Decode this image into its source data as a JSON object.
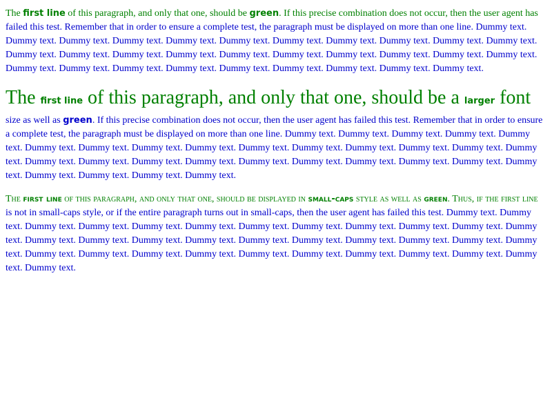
{
  "paragraphs": [
    {
      "intro": "The ",
      "bold1": "first line",
      "mid": " of this paragraph, and only that one, should be ",
      "bold2": "green",
      "rest": ". If this precise combination does not occur, then the user agent has failed this test. Remember that in order to ensure a complete test, the paragraph must be displayed on more than one line. Dummy text. Dummy text. Dummy text. Dummy text. Dummy text. Dummy text. Dummy text. Dummy text. Dummy text. Dummy text. Dummy text. Dummy text. Dummy text. Dummy text. Dummy text. Dummy text. Dummy text. Dummy text. Dummy text. Dummy text. Dummy text. Dummy text. Dummy text. Dummy text. Dummy text. Dummy text. Dummy text. Dummy text. Dummy text. Dummy text."
    },
    {
      "intro": "The ",
      "bold1": "first line",
      "mid": " of this paragraph, and only that one, should be a ",
      "bold2": "larger",
      "mid2": " font size as well as ",
      "bold3": "green",
      "rest": ". If this precise combination does not occur, then the user agent has failed this test. Remember that in order to ensure a complete test, the paragraph must be displayed on more than one line. Dummy text. Dummy text. Dummy text. Dummy text. Dummy text. Dummy text. Dummy text. Dummy text. Dummy text. Dummy text. Dummy text. Dummy text. Dummy text. Dummy text. Dummy text. Dummy text. Dummy text. Dummy text. Dummy text. Dummy text. Dummy text. Dummy text. Dummy text. Dummy text. Dummy text. Dummy text. Dummy text. Dummy text. Dummy text."
    },
    {
      "intro": "The ",
      "bold1": "first line",
      "mid": " of this paragraph, and only that one, should be displayed in ",
      "bold2": "small-caps",
      "mid2": " style as well as ",
      "bold3": "green",
      "rest": ". Thus, if the first line is not in small-caps style, or if the entire paragraph turns out in small-caps, then the user agent has failed this test. Dummy text. Dummy text. Dummy text. Dummy text. Dummy text. Dummy text. Dummy text. Dummy text. Dummy text. Dummy text. Dummy text. Dummy text. Dummy text. Dummy text. Dummy text. Dummy text. Dummy text. Dummy text. Dummy text. Dummy text. Dummy text. Dummy text. Dummy text. Dummy text. Dummy text. Dummy text. Dummy text. Dummy text. Dummy text. Dummy text. Dummy text. Dummy text. Dummy text."
    }
  ],
  "colors": {
    "text": "#0000cc",
    "first_line": "#008000",
    "background": "#ffffff"
  }
}
